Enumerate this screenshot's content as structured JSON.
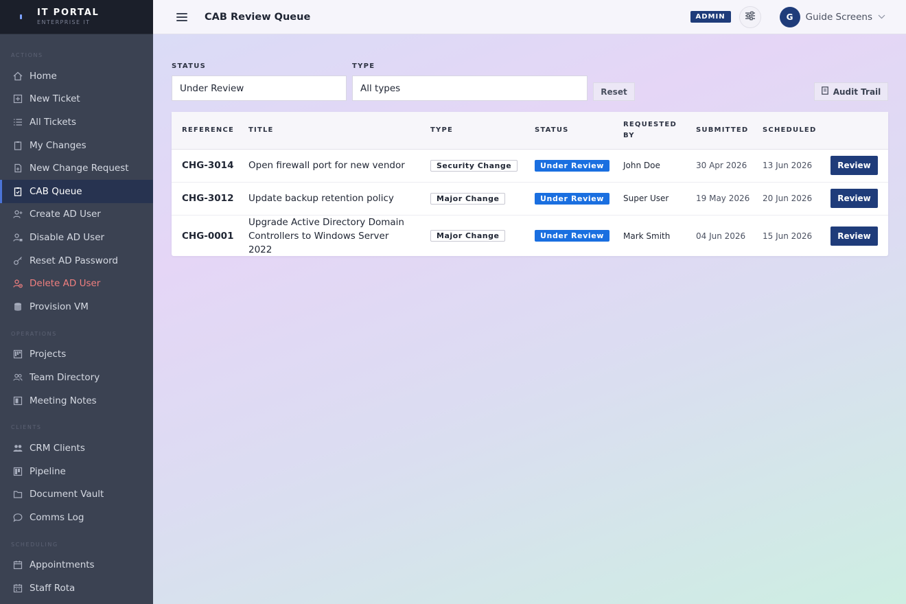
{
  "brand": {
    "title": "IT PORTAL",
    "subtitle": "ENTERPRISE IT"
  },
  "sidebar": {
    "sections": [
      {
        "label": "ACTIONS",
        "items": [
          {
            "label": "Home",
            "icon": "home-icon"
          },
          {
            "label": "New Ticket",
            "icon": "plus-square-icon"
          },
          {
            "label": "All Tickets",
            "icon": "list-icon"
          },
          {
            "label": "My Changes",
            "icon": "clipboard-icon"
          },
          {
            "label": "New Change Request",
            "icon": "file-plus-icon"
          },
          {
            "label": "CAB Queue",
            "icon": "clipboard-check-icon",
            "active": true
          },
          {
            "label": "Create AD User",
            "icon": "user-plus-icon"
          },
          {
            "label": "Disable AD User",
            "icon": "user-lock-icon"
          },
          {
            "label": "Reset AD Password",
            "icon": "key-icon"
          },
          {
            "label": "Delete AD User",
            "icon": "user-minus-icon",
            "danger": true
          },
          {
            "label": "Provision VM",
            "icon": "database-icon"
          }
        ]
      },
      {
        "label": "OPERATIONS",
        "items": [
          {
            "label": "Projects",
            "icon": "kanban-icon"
          },
          {
            "label": "Team Directory",
            "icon": "users-icon"
          },
          {
            "label": "Meeting Notes",
            "icon": "notes-icon"
          }
        ]
      },
      {
        "label": "CLIENTS",
        "items": [
          {
            "label": "CRM Clients",
            "icon": "people-icon"
          },
          {
            "label": "Pipeline",
            "icon": "pipeline-icon"
          },
          {
            "label": "Document Vault",
            "icon": "folder-icon"
          },
          {
            "label": "Comms Log",
            "icon": "chat-icon"
          }
        ]
      },
      {
        "label": "SCHEDULING",
        "items": [
          {
            "label": "Appointments",
            "icon": "calendar-icon"
          },
          {
            "label": "Staff Rota",
            "icon": "calendar-grid-icon"
          }
        ]
      }
    ]
  },
  "header": {
    "title": "CAB Review Queue",
    "admin_badge": "ADMIN",
    "user_initial": "G",
    "user_name": "Guide Screens"
  },
  "filters": {
    "status_label": "STATUS",
    "status_value": "Under Review",
    "type_label": "TYPE",
    "type_value": "All types",
    "reset_label": "Reset",
    "audit_label": "Audit Trail"
  },
  "table": {
    "columns": [
      "REFERENCE",
      "TITLE",
      "TYPE",
      "STATUS",
      "REQUESTED BY",
      "SUBMITTED",
      "SCHEDULED",
      ""
    ],
    "rows": [
      {
        "ref": "CHG-3014",
        "title": "Open firewall port for new vendor",
        "type": "Security Change",
        "status": "Under Review",
        "requested_by": "John Doe",
        "submitted": "30 Apr 2026",
        "scheduled": "13 Jun 2026",
        "action": "Review"
      },
      {
        "ref": "CHG-3012",
        "title": "Update backup retention policy",
        "type": "Major Change",
        "status": "Under Review",
        "requested_by": "Super User",
        "submitted": "19 May 2026",
        "scheduled": "20 Jun 2026",
        "action": "Review"
      },
      {
        "ref": "CHG-0001",
        "title": "Upgrade Active Directory Domain Controllers to Windows Server 2022",
        "type": "Major Change",
        "status": "Under Review",
        "requested_by": "Mark Smith",
        "submitted": "04 Jun 2026",
        "scheduled": "15 Jun 2026",
        "action": "Review"
      }
    ]
  },
  "colors": {
    "accent": "#1f3c7a",
    "status_blue": "#1a6fe0",
    "danger": "#f07f7f",
    "sidebar_bg": "#3b4252"
  }
}
